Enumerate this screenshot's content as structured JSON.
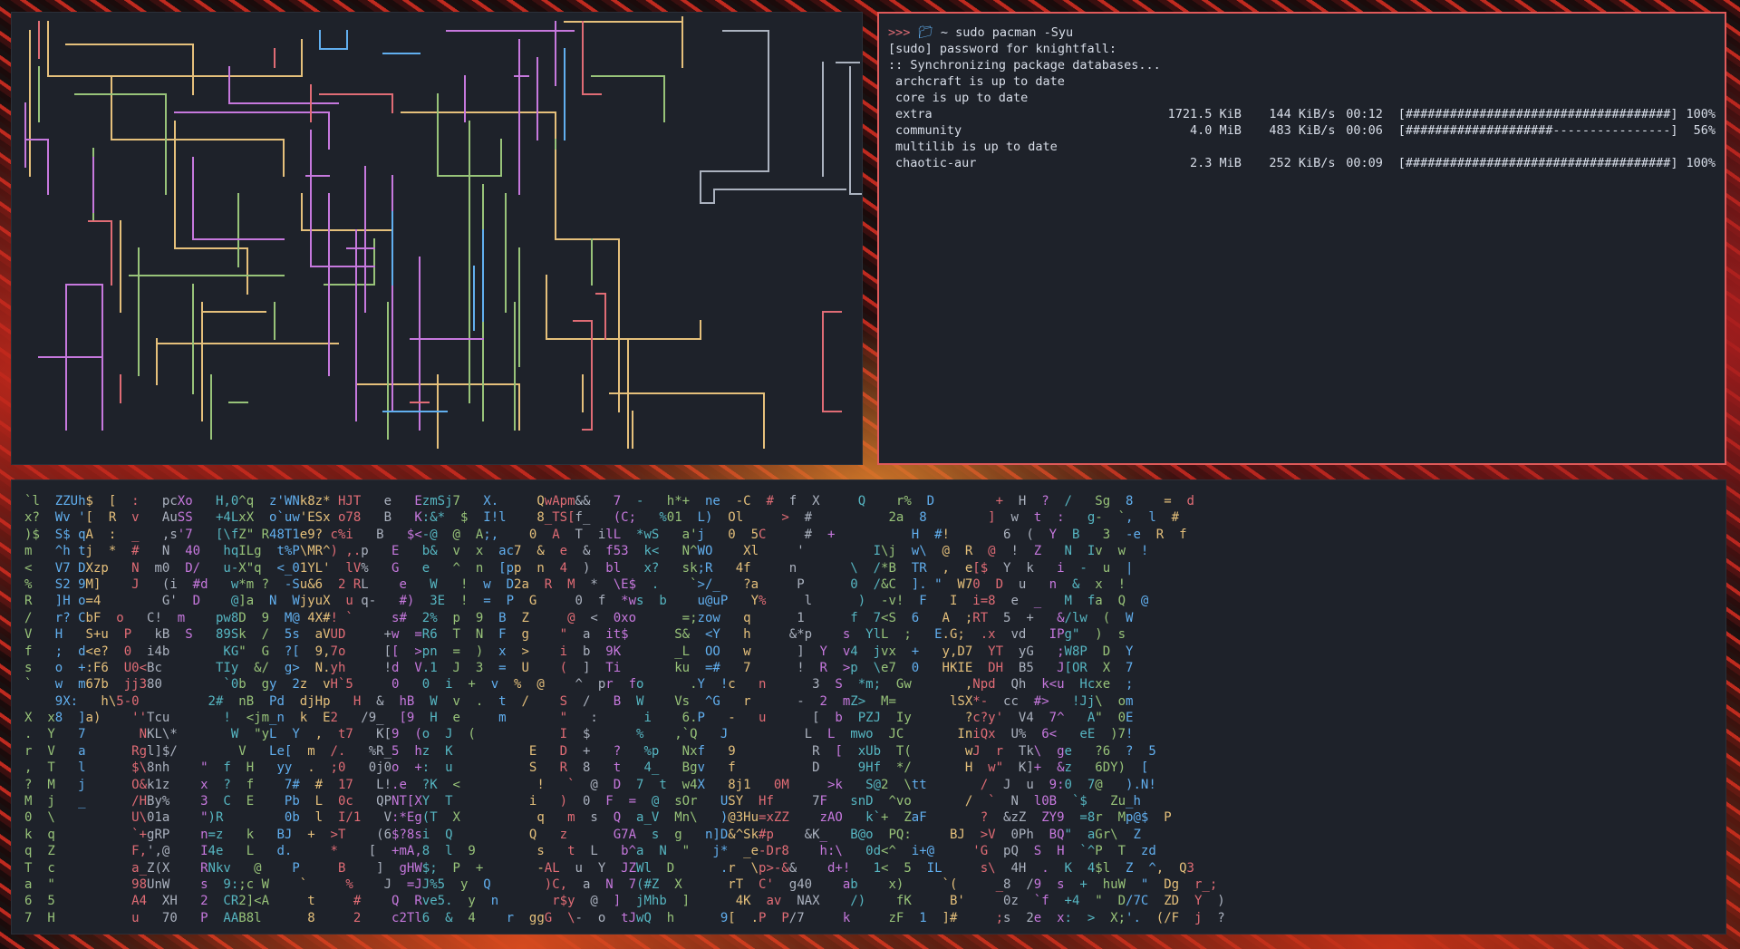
{
  "colors": {
    "window_bg": "#1e222a",
    "accent_border": "#e05a5a",
    "pipe_palette": [
      "#e5c07b",
      "#98c379",
      "#c678dd",
      "#e06c75",
      "#61afef",
      "#abb2bf"
    ],
    "matrix_palette": [
      "#e5c07b",
      "#98c379",
      "#c678dd",
      "#e06c75",
      "#61afef",
      "#56b6c2",
      "#abb2bf"
    ]
  },
  "icons": {
    "prompt_folder": "folder-icon"
  },
  "pacman": {
    "prompt_arrows": ">>>",
    "prompt_dir": "~",
    "command": "sudo pacman -Syu",
    "password_line": "[sudo] password for knightfall:",
    "sync_line": ":: Synchronizing package databases...",
    "lines": [
      {
        "name": "archcraft is up to date",
        "size": "",
        "rate": "",
        "time": "",
        "bar": "",
        "pct": ""
      },
      {
        "name": "core is up to date",
        "size": "",
        "rate": "",
        "time": "",
        "bar": "",
        "pct": ""
      },
      {
        "name": "extra",
        "size": "1721.5 KiB",
        "rate": "144 KiB/s",
        "time": "00:12",
        "bar": "[####################################]",
        "pct": "100%"
      },
      {
        "name": "community",
        "size": "4.0 MiB",
        "rate": "483 KiB/s",
        "time": "00:06",
        "bar": "[####################----------------]",
        "pct": "56%"
      },
      {
        "name": "multilib is up to date",
        "size": "",
        "rate": "",
        "time": "",
        "bar": "",
        "pct": ""
      },
      {
        "name": "chaotic-aur",
        "size": "2.3 MiB",
        "rate": "252 KiB/s",
        "time": "00:09",
        "bar": "[####################################]",
        "pct": "100%"
      }
    ]
  },
  "matrix": {
    "lines": [
      "`l  ZZUh$  [  :   pcXo   H,0^q  z'WNk8z* HJT   e   EzmSj7   X.     QwApm&&   7  -   h*+  ne  -C  #  f  X     Q    r%  D        +  H  ?  /   Sg  8    =  d",
      "x?  Wv '[  R  v   AuSS   +4LxX  o`uw'ESx o78   B   K:&*  $  I!l    8_TS[f_   (C;   %01  L)  Ol     >  #          2a  8        ]  w  t  :   g-  `,  l  #",
      ")$  S$ qA  :  _   ,s'7   [\\fZ\" R48T1e9? c%i   B   $<-@  @  A;,    0  A  T  ilL  *wS   a'j   0  5C     #  +          H  #!       6  (  Y  B   3  -e  R  f",
      "m   ^h tj  *  #   N  40   hqILg  t%P\\MR^) ,.p   E   b&  v  x  ac7  &  e  &  f53  k<   N^WO    Xl     '         I\\j  w\\  @  R  @  !  Z   N  Iv  w  !",
      "<   V7 DXzp   N  m0  D/   u-X\"q  <_01YL'  lV%   G   e   ^  n  [pp  n  4  )  bl   x?   sk;R   4f     n       \\  /*B  TR  ,  e[$  Y  k   i  -  u  |",
      "%   S2 9M]    J   (i  #d   w*m ?  -Su&6  2 RL    e   W   !  w  D2a  R  M  *  \\E$  .    `>/_   ?a     P      0  /&C  ]. \"  W70  D  u   n  &  x  !",
      "R   ]H o=4        G'  D    @]a  N  WjyuX  u q-   #)  3E  !  =  P  G     0  f  *ws  b    u@uP   Y%     l      )  -v!  F   I  i=8  e  _   M  fa  Q  @",
      "/   r? CbF  o   C!  m    pw8D  9  M@ 4X#! `     s#  2%  p  9  B  Z     @  <  0xo      =;zow   q      1      f  7<S  6   A  ;RT  5  +   &/lw  (  W",
      "V   H   S+u  P   kB  S   89Sk  /  5s  aVUD     +w  =R6  T  N  F  g    \"  a  it$      S&  <Y   h     &*p    s  YlL  ;   E.G;  .x  vd   IPg\"  )  s",
      "f   ;  d<e?  0  i4b       KG\"  G  ?[  9,7o     [[  >pn  =  )  x  >    i  b  9K       _L  OO   w      ]  Y  v4  jvx  +   y,D7  YT  yG   ;W8P  D  Y",
      "s   o  +:F6  U0<Bc       TIy  &/  g>  N.yh     !d  V.1  J  3  =  U    (  ]  Ti       ku  =#   7      !  R  >p  \\e7  0   HKIE  DH  B5   J[OR  X  7",
      "`   w  m67b  jj380        `0b  gy  2z  vH`5     0   0  i  +  v  %  @    ^  pr  fo      .Y  !c   n      3  S  *m;  Gw       ,Npd  Qh  k<u  Hcxe  ;",
      "    9X:   h\\5-0         2#  nB  Pd  djHp   H  &  hB  W  v  .  t  /    S  /   B  W    Vs  ^G   r      -  2  mZ>  M=       lSX*-  cc  #>   !Jj\\  om",
      "X  x8  ]a)    ''Tcu       !  <jm_n  k  E2   /9_  [9  H  e     m       \"   :      i    6.P   -   u      [  b  PZJ  Iy       ?c?y'  V4  7^   A\"  0E",
      ".  Y   7       NKL\\*       W  \"yL  Y  ,  t7   K[9  (o  J  (           I  $      %    ,`Q   J          L  L  mwo  JC       IniQx  U%  6<   eE  )7!",
      "r  V   a      Rgl]$/        V   Le[  m  /.   %R_5  hz  K          E   D  +   ?   %p   Nxf   9          R  [  xUb  T(       wJ  r  Tk\\  ge   ?6  ?  5",
      ",  T   l      $\\8nh    \"  f  H   yy  .  ;0   0j0o  +:  u          S   R  8   t   4_   Bgv   f          D     9Hf  */       H  w\"  K]+  &z   6DY)  [",
      "?  M   j      O&k1z    x  ?  f    7#  #  17   L!.e  ?K  <          !   `  @  D  7  t  w4X   8j1   0M     >k   S@2  \\tt       /  J  u  9:0  7@   ).N!",
      "M  j   _      /HBy%    3  C  E    Pb  L  0c   QPNT[XY  T          i   )  0  F  =  @  sOr   USY  Hf     7F   snD  ^vo       /  `  N  l0B  `$   Zu_h",
      "0  \\          U\\01a    \")R        0b  l  I/1   V:*Eg(T  X          q   m  s  Q  a_V  Mn\\   )@3Hu=xZZ    zAO   k`+  ZaF       ?  &zZ  ZY9  =8r  Mp@$  P",
      "k  q          `+gRP    n=z   k   BJ  +  >T    (6$?8si  Q          Q   z      G7A  s  g   n]D&^Sk#p    &K_   B@o  PQ:     BJ  >V  0Ph  BQ\"  aGr\\  Z",
      "q  Z          F,',@    I4e   L   d.     *    [  +mA,8  l  9        s   t  L   b^a  N  \"   j*  _e-Dr8    h:\\   0d<^  i+@     'G  pQ  S  H  `^P  T  zd",
      "T  c          a_Z(X    RNkv   @    P     B    ]  gHW$;  P  +       -AL  u  Y  JZWl  D      .r  \\p>-&&    d+!   1<  5  IL     s\\  4H  .  K  4$l  Z  ^,  Q3",
      "a  \"          98UnW    s  9:;c W    `     %    J  =JJ%5  y  Q       )C,  a  N  7(#Z  X      rT  C'  g40    ab    x)     `(     _8  /9  s  +  huW  \"  Dg  r_;",
      "6  5          A4  XH   2  CR2]<A     t     #    Q  Rve5.  y  n       r$y  @  ]  jMhb  ]      4K  av  NAX    /)    fK     B'     0z  `f  +4  \"  D/7C  ZD  Y  )",
      "7  H          u   70   P  AAB8l      8     2    c2Tl6  &  4    r  ggG  \\-  o  tJwQ  h      9[  .P  P/7     k     zF  1  ]#     ;s  2e  x:  >  X;'.  (/F  j  ?"
    ]
  }
}
